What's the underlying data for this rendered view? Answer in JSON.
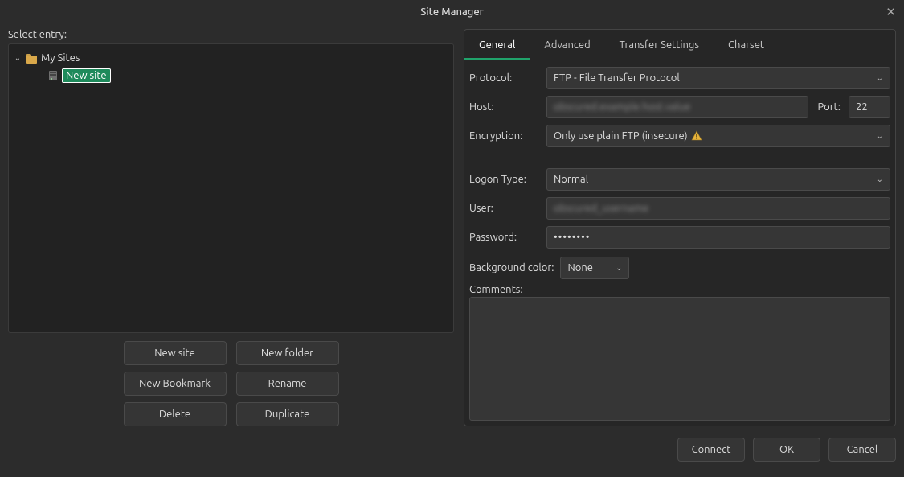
{
  "window": {
    "title": "Site Manager"
  },
  "left": {
    "select_label": "Select entry:",
    "root_label": "My Sites",
    "site_label": "New site",
    "buttons": {
      "new_site": "New site",
      "new_folder": "New folder",
      "new_bookmark": "New Bookmark",
      "rename": "Rename",
      "delete": "Delete",
      "duplicate": "Duplicate"
    }
  },
  "tabs": {
    "general": "General",
    "advanced": "Advanced",
    "transfer": "Transfer Settings",
    "charset": "Charset"
  },
  "form": {
    "protocol_label": "Protocol:",
    "protocol_value": "FTP - File Transfer Protocol",
    "host_label": "Host:",
    "host_value": "",
    "port_label": "Port:",
    "port_value": "22",
    "encryption_label": "Encryption:",
    "encryption_value": "Only use plain FTP (insecure)",
    "logon_label": "Logon Type:",
    "logon_value": "Normal",
    "user_label": "User:",
    "user_value": "",
    "password_label": "Password:",
    "password_value": "••••••••",
    "bgcolor_label": "Background color:",
    "bgcolor_value": "None",
    "comments_label": "Comments:"
  },
  "footer": {
    "connect": "Connect",
    "ok": "OK",
    "cancel": "Cancel"
  }
}
